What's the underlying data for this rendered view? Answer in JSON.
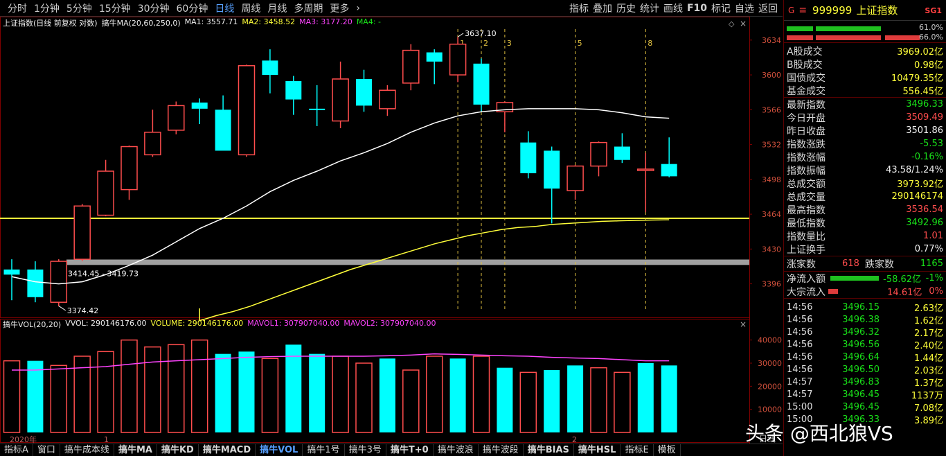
{
  "toolbar": {
    "periods": [
      "分时",
      "1分钟",
      "5分钟",
      "15分钟",
      "30分钟",
      "60分钟",
      "日线",
      "周线",
      "月线",
      "多周期",
      "更多"
    ],
    "active_period": "日线",
    "right_items": [
      "指标",
      "叠加",
      "历史",
      "统计",
      "画线",
      "F10",
      "标记",
      "自选",
      "返回"
    ]
  },
  "chart": {
    "title": "上证指数(日线 前复权 对数)",
    "ma_label": "搞牛MA(20,60,250,0)",
    "ma1": "MA1: 3557.71",
    "ma2": "MA2: 3458.52",
    "ma3": "MA3: 3177.20",
    "ma4": "MA4: -",
    "price_axis": [
      "3634",
      "3600",
      "3566",
      "3532",
      "3498",
      "3464",
      "3430",
      "3396"
    ],
    "high_marker": "3637.10",
    "low_marker": "3374.42",
    "band_label": "3414.45 - 3419.73",
    "markers": [
      "1",
      "2",
      "3",
      "5",
      "8"
    ],
    "x_labels": [
      "2020年",
      "1",
      "2"
    ],
    "colors": {
      "up": "#ff4d4d",
      "down": "#00ffff",
      "ma1": "#ffffff",
      "ma2": "#ffff3a",
      "ma3": "#ff44ff",
      "band": "#a0a0a0",
      "hline": "#ffff3a"
    }
  },
  "volume": {
    "label": "搞牛VOL(20,20)",
    "vvol": "VVOL: 290146176.00",
    "volume": "VOLUME: 290146176.00",
    "mavol1": "MAVOL1: 307907040.00",
    "mavol2": "MAVOL2: 307907040.00",
    "axis": [
      "40000",
      "30000",
      "20000",
      "10000"
    ]
  },
  "chart_data": {
    "type": "candlestick",
    "title": "上证指数(日线 前复权 对数)",
    "candles": [
      {
        "o": 3410,
        "h": 3420,
        "l": 3380,
        "c": 3405
      },
      {
        "o": 3410,
        "h": 3418,
        "l": 3378,
        "c": 3383
      },
      {
        "o": 3378,
        "h": 3420,
        "l": 3374,
        "c": 3418
      },
      {
        "o": 3420,
        "h": 3474,
        "l": 3418,
        "c": 3472
      },
      {
        "o": 3463,
        "h": 3517,
        "l": 3462,
        "c": 3506
      },
      {
        "o": 3488,
        "h": 3531,
        "l": 3478,
        "c": 3530
      },
      {
        "o": 3522,
        "h": 3566,
        "l": 3520,
        "c": 3544
      },
      {
        "o": 3546,
        "h": 3574,
        "l": 3542,
        "c": 3570
      },
      {
        "o": 3573,
        "h": 3577,
        "l": 3552,
        "c": 3567
      },
      {
        "o": 3566,
        "h": 3580,
        "l": 3527,
        "c": 3526
      },
      {
        "o": 3522,
        "h": 3610,
        "l": 3520,
        "c": 3609
      },
      {
        "o": 3614,
        "h": 3625,
        "l": 3582,
        "c": 3600
      },
      {
        "o": 3594,
        "h": 3599,
        "l": 3561,
        "c": 3576
      },
      {
        "o": 3567,
        "h": 3590,
        "l": 3550,
        "c": 3566
      },
      {
        "o": 3555,
        "h": 3613,
        "l": 3548,
        "c": 3596
      },
      {
        "o": 3596,
        "h": 3605,
        "l": 3564,
        "c": 3570
      },
      {
        "o": 3567,
        "h": 3590,
        "l": 3560,
        "c": 3585
      },
      {
        "o": 3592,
        "h": 3630,
        "l": 3585,
        "c": 3624
      },
      {
        "o": 3622,
        "h": 3625,
        "l": 3591,
        "c": 3613
      },
      {
        "o": 3600,
        "h": 3637.1,
        "l": 3593,
        "c": 3630
      },
      {
        "o": 3611,
        "h": 3616,
        "l": 3564,
        "c": 3571
      },
      {
        "o": 3564,
        "h": 3574,
        "l": 3544,
        "c": 3573
      },
      {
        "o": 3534,
        "h": 3545,
        "l": 3499,
        "c": 3504
      },
      {
        "o": 3526,
        "h": 3530,
        "l": 3455,
        "c": 3489
      },
      {
        "o": 3487,
        "h": 3512,
        "l": 3478,
        "c": 3511
      },
      {
        "o": 3511,
        "h": 3535,
        "l": 3501,
        "c": 3534
      },
      {
        "o": 3530,
        "h": 3543,
        "l": 3514,
        "c": 3517
      },
      {
        "o": 3508,
        "h": 3524,
        "l": 3466,
        "c": 3508
      },
      {
        "o": 3513,
        "h": 3539,
        "l": 3500,
        "c": 3501
      }
    ],
    "volume": [
      31,
      31,
      29,
      33,
      35,
      40,
      37,
      38,
      40,
      34,
      35,
      32,
      38,
      34,
      33,
      30,
      32,
      27,
      33,
      32,
      33,
      28,
      26,
      27,
      29,
      28,
      26,
      30,
      29
    ],
    "volume_dir": [
      "u",
      "d",
      "u",
      "u",
      "u",
      "u",
      "u",
      "u",
      "u",
      "d",
      "d",
      "u",
      "d",
      "d",
      "u",
      "u",
      "d",
      "u",
      "u",
      "d",
      "u",
      "d",
      "u",
      "d",
      "d",
      "u",
      "u",
      "d",
      "d"
    ],
    "mavol": [
      27,
      27,
      27.5,
      28,
      28.5,
      29.5,
      30.5,
      31,
      31.5,
      32,
      32.5,
      32.8,
      33,
      33,
      33,
      33,
      33.2,
      33.5,
      34,
      33.8,
      33.5,
      33.2,
      33,
      32.5,
      32.2,
      32,
      31.5,
      31,
      31
    ]
  },
  "panel": {
    "g": "G",
    "code": "999999",
    "name": "上证指数",
    "sg": "SG1",
    "bar_pct_top": "61.0%",
    "bar_pct_bottom": "66.0%",
    "stats": [
      {
        "label": "A股成交",
        "value": "3969.02亿",
        "color": "yellow"
      },
      {
        "label": "B股成交",
        "value": "0.98亿",
        "color": "yellow"
      },
      {
        "label": "国债成交",
        "value": "10479.35亿",
        "color": "yellow"
      },
      {
        "label": "基金成交",
        "value": "556.45亿",
        "color": "yellow"
      }
    ],
    "quote": [
      {
        "label": "最新指数",
        "value": "3496.33",
        "color": "green"
      },
      {
        "label": "今日开盘",
        "value": "3509.49",
        "color": "red"
      },
      {
        "label": "昨日收盘",
        "value": "3501.86",
        "color": "white"
      },
      {
        "label": "指数涨跌",
        "value": "-5.53",
        "color": "green"
      },
      {
        "label": "指数涨幅",
        "value": "-0.16%",
        "color": "green"
      },
      {
        "label": "指数振幅",
        "value": "43.58/1.24%",
        "color": "white"
      },
      {
        "label": "总成交额",
        "value": "3973.92亿",
        "color": "yellow"
      },
      {
        "label": "总成交量",
        "value": "290146174",
        "color": "yellow"
      },
      {
        "label": "最高指数",
        "value": "3536.54",
        "color": "red"
      },
      {
        "label": "最低指数",
        "value": "3492.96",
        "color": "green"
      },
      {
        "label": "指数量比",
        "value": "1.01",
        "color": "red"
      },
      {
        "label": "上证换手",
        "value": "0.77%",
        "color": "white"
      }
    ],
    "rise_label": "涨家数",
    "rise": "618",
    "fall_label": "跌家数",
    "fall": "1165",
    "net_inflow_label": "净流入额",
    "net_inflow": "-58.62亿",
    "net_inflow_pct": "-1%",
    "block_label": "大宗流入",
    "block": "14.61亿",
    "block_pct": "0%",
    "ticks": [
      {
        "t": "14:56",
        "p": "3496.15",
        "v": "2.63亿"
      },
      {
        "t": "14:56",
        "p": "3496.38",
        "v": "1.62亿"
      },
      {
        "t": "14:56",
        "p": "3496.32",
        "v": "2.17亿"
      },
      {
        "t": "14:56",
        "p": "3496.56",
        "v": "2.40亿"
      },
      {
        "t": "14:56",
        "p": "3496.64",
        "v": "1.44亿"
      },
      {
        "t": "14:56",
        "p": "3496.50",
        "v": "2.03亿"
      },
      {
        "t": "14:57",
        "p": "3496.83",
        "v": "1.37亿"
      },
      {
        "t": "14:57",
        "p": "3496.45",
        "v": "1137万"
      },
      {
        "t": "15:00",
        "p": "3496.45",
        "v": "7.08亿"
      },
      {
        "t": "15:00",
        "p": "3496.33",
        "v": "3.89亿"
      }
    ]
  },
  "tabs": [
    {
      "label": "指标A",
      "active": false,
      "bold": false
    },
    {
      "label": "窗口",
      "active": false,
      "bold": false
    },
    {
      "label": "搞牛成本线",
      "active": false,
      "bold": false
    },
    {
      "label": "搞牛MA",
      "active": false,
      "bold": true
    },
    {
      "label": "搞牛KD",
      "active": false,
      "bold": true
    },
    {
      "label": "搞牛MACD",
      "active": false,
      "bold": true
    },
    {
      "label": "搞牛VOL",
      "active": true,
      "bold": true
    },
    {
      "label": "搞牛1号",
      "active": false,
      "bold": false
    },
    {
      "label": "搞牛3号",
      "active": false,
      "bold": false
    },
    {
      "label": "搞牛T+0",
      "active": false,
      "bold": true
    },
    {
      "label": "搞牛波浪",
      "active": false,
      "bold": false
    },
    {
      "label": "搞牛波段",
      "active": false,
      "bold": false
    },
    {
      "label": "搞牛BIAS",
      "active": false,
      "bold": true
    },
    {
      "label": "搞牛HSL",
      "active": false,
      "bold": true
    },
    {
      "label": "指标E",
      "active": false,
      "bold": false
    },
    {
      "label": "模板",
      "active": false,
      "bold": false
    }
  ],
  "bottom_right": "日线",
  "watermark": "头条 @西北狼VS"
}
